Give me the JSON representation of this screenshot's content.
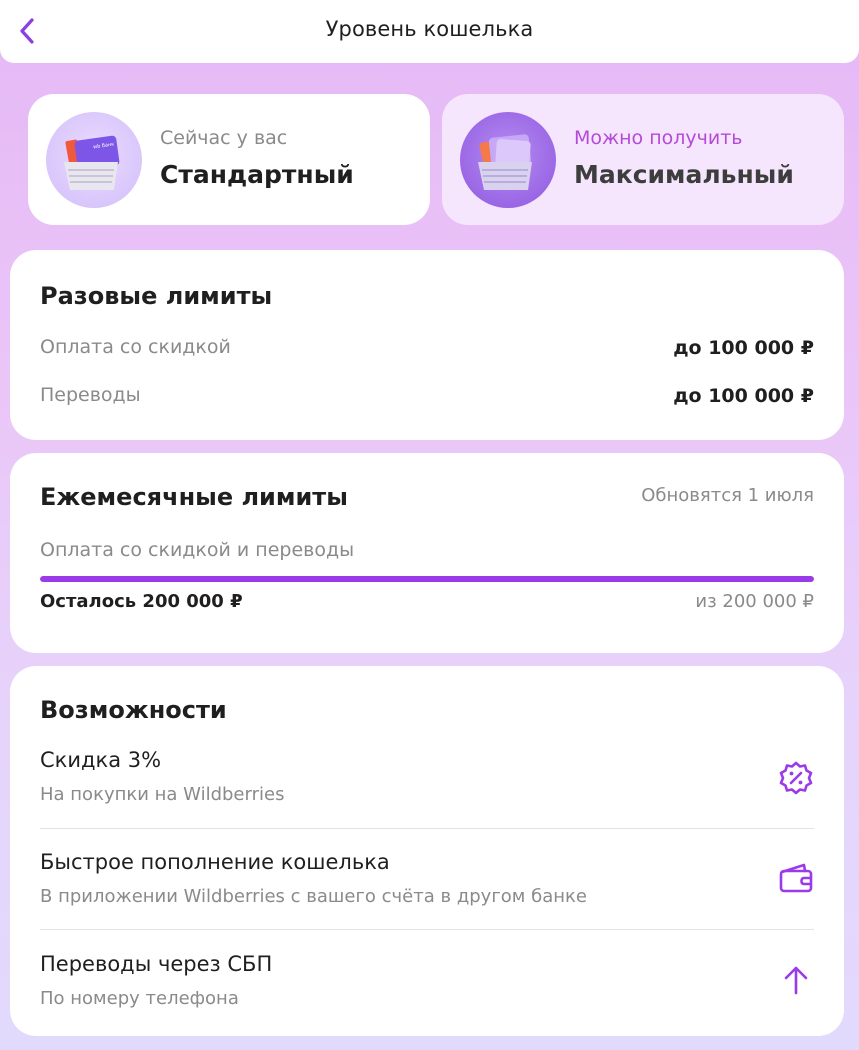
{
  "header": {
    "title": "Уровень кошелька",
    "back_icon": "chevron-left-icon"
  },
  "levels": {
    "current": {
      "caption": "Сейчас у вас",
      "name": "Стандартный",
      "card_text": "wb банк"
    },
    "next": {
      "caption": "Можно получить",
      "name": "Максимальный"
    }
  },
  "one_time_limits": {
    "title": "Разовые лимиты",
    "rows": [
      {
        "label": "Оплата со скидкой",
        "value": "до 100 000 ₽"
      },
      {
        "label": "Переводы",
        "value": "до 100 000 ₽"
      }
    ]
  },
  "monthly_limits": {
    "title": "Ежемесячные лимиты",
    "updates": "Обновятся 1 июля",
    "label": "Оплата со скидкой и переводы",
    "remaining": "Осталось 200 000 ₽",
    "total": "из 200 000 ₽",
    "progress_fraction": 1.0
  },
  "features": {
    "title": "Возможности",
    "items": [
      {
        "title": "Скидка 3%",
        "description": "На покупки на Wildberries",
        "icon": "discount-badge-icon"
      },
      {
        "title": "Быстрое пополнение кошелька",
        "description": "В приложении Wildberries с вашего счёта в другом банке",
        "icon": "wallet-icon"
      },
      {
        "title": "Переводы через СБП",
        "description": "По номеру телефона",
        "icon": "arrow-up-icon"
      }
    ]
  },
  "colors": {
    "accent": "#9b3ae8",
    "accent_text": "#b44ad8",
    "secondary_text": "#8a8a8a",
    "primary_text": "#1f1f1f"
  }
}
